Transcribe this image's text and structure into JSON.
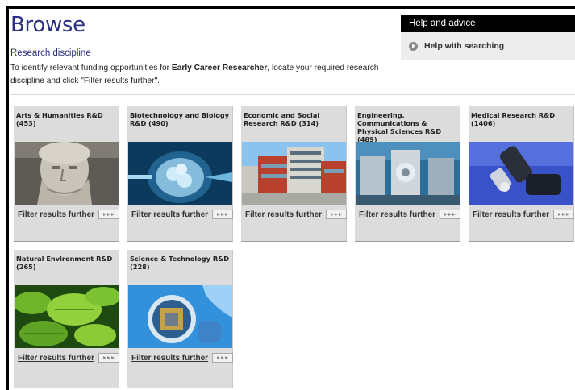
{
  "page": {
    "title": "Browse",
    "subheading": "Research discipline",
    "intro_prefix": "To identify relevant funding opportunities for ",
    "intro_bold": "Early Career Researcher",
    "intro_suffix": ", locate your required research discipline and click \"Filter results further\"."
  },
  "help": {
    "header": "Help and advice",
    "link_label": "Help with searching",
    "link_icon": "arrow-circle-icon"
  },
  "cards": [
    {
      "title": "Arts & Humanities R&D (453)",
      "image": "classical-bust-image",
      "link": "Filter results further"
    },
    {
      "title": "Biotechnology and Biology R&D (490)",
      "image": "cell-microinjection-image",
      "link": "Filter results further"
    },
    {
      "title": "Economic and Social Research R&D (314)",
      "image": "modern-building-image",
      "link": "Filter results further"
    },
    {
      "title": "Engineering, Communications & Physical Sciences R&D (489)",
      "image": "machinery-image",
      "link": "Filter results further"
    },
    {
      "title": "Medical Research R&D (1406)",
      "image": "microscope-image",
      "link": "Filter results further"
    },
    {
      "title": "Natural Environment R&D (265)",
      "image": "oak-leaves-image",
      "link": "Filter results further"
    },
    {
      "title": "Science & Technology R&D (228)",
      "image": "microchip-wafer-image",
      "link": "Filter results further"
    }
  ],
  "colors": {
    "title_blue": "#2b2f82",
    "card_bg": "#dcdcdc",
    "help_header_bg": "#000000",
    "help_panel_bg": "#ededed"
  }
}
